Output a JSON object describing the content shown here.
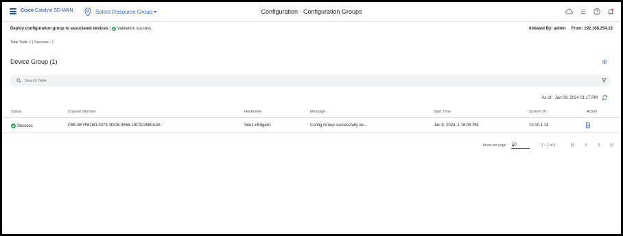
{
  "topbar": {
    "brand_bold": "Cisco",
    "brand_rest": "Catalyst SD-WAN",
    "resource_group_label": "Select Resource Group",
    "page_title": "Configuration · Configuration Groups",
    "icons": [
      "cloud-icon",
      "list-icon",
      "help-icon",
      "bell-icon"
    ]
  },
  "status": {
    "deploy_text": "Deploy configuration group to associated devices",
    "separator": "|",
    "validation_text": "Validation success",
    "initiated_by": "Initiated By: admin",
    "from": "From: 192.168.254.22",
    "total_task": "Total Task: 1 | Success : 1"
  },
  "device_group": {
    "title": "Device Group (1)",
    "search_placeholder": "Search Table",
    "as_of_label": "As of:",
    "as_of_value": "Jan 09, 2024 01:17 PM"
  },
  "table": {
    "columns": [
      "Status",
      "Chassis Number",
      "Hostname",
      "Message",
      "Start Time",
      "System IP",
      "Action"
    ],
    "rows": [
      {
        "status": "Success",
        "chassis": "C8K-8E7F818D-3379-3DD6-3556-19C322680AA5",
        "hostname": "Site1-cEdge01",
        "message": "Config Group successfully de...",
        "start_time": "Jan 9, 2024, 1:16:05 PM",
        "system_ip": "10.10.1.13",
        "action_icon": "document-icon"
      }
    ]
  },
  "pagination": {
    "items_per_page_label": "Items per page:",
    "items_per_page_value": "10",
    "range_text": "1 – 1 of 1"
  },
  "colors": {
    "brand_blue": "#1f4e9c",
    "link_blue": "#3069bd",
    "success_green": "#2ba34a",
    "search_bg": "#f2f3f4"
  }
}
